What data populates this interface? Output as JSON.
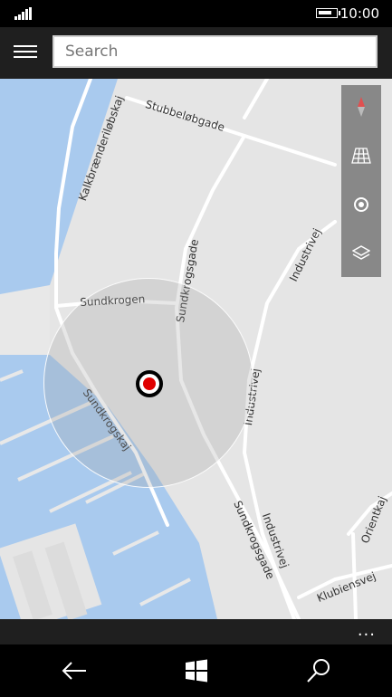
{
  "status": {
    "time": "10:00",
    "battery_level": 0.85
  },
  "search": {
    "placeholder": "Search",
    "value": ""
  },
  "map": {
    "streets": {
      "stubbelobgade": "Stubbeløbgade",
      "kalkbraenderilobskaj": "Kalkbrænderiløbskaj",
      "sundkrogen": "Sundkrogen",
      "sundkrogsgade_north": "Sundkrogsgade",
      "industrivej_north": "Industrivej",
      "industrivej_mid": "Industrivej",
      "sundkrogskaj": "Sundkrogskaj",
      "sundkrogsgade_south": "Sundkrogsgade",
      "industrivej_south": "Industrivej",
      "orientkaj": "Orientkaj",
      "klubiensvej": "Klubiensvej"
    },
    "controls": [
      "compass-icon",
      "3d-view-icon",
      "my-location-icon",
      "map-layers-icon"
    ]
  },
  "app_bar": {
    "more_label": "..."
  },
  "colors": {
    "water": "#a9caee",
    "land": "#e5e5e5",
    "road": "#ffffff",
    "accent": "#e00000"
  }
}
